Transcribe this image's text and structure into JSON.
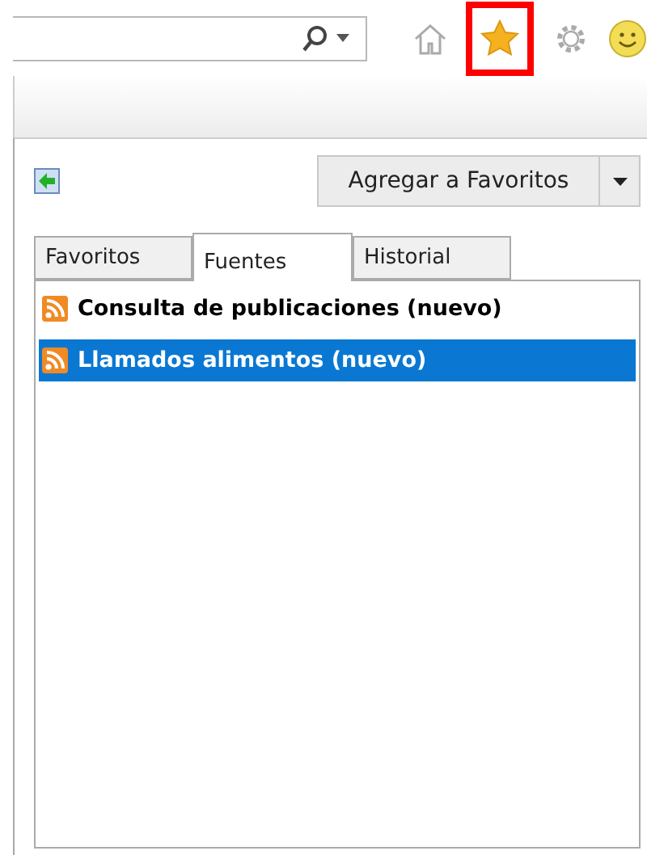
{
  "toolbar": {
    "icons": [
      {
        "kind": "home",
        "highlighted": false
      },
      {
        "kind": "star",
        "highlighted": true
      },
      {
        "kind": "gear",
        "highlighted": false
      },
      {
        "kind": "smiley",
        "highlighted": false
      }
    ]
  },
  "panel": {
    "add_button": "Agregar a Favoritos",
    "tabs": [
      {
        "label": "Favoritos",
        "selected": false
      },
      {
        "label": "Fuentes",
        "selected": true
      },
      {
        "label": "Historial",
        "selected": false
      }
    ],
    "feeds": [
      {
        "title": "Consulta de publicaciones (nuevo)",
        "selected": false
      },
      {
        "title": "Llamados alimentos (nuevo)",
        "selected": true
      }
    ]
  }
}
